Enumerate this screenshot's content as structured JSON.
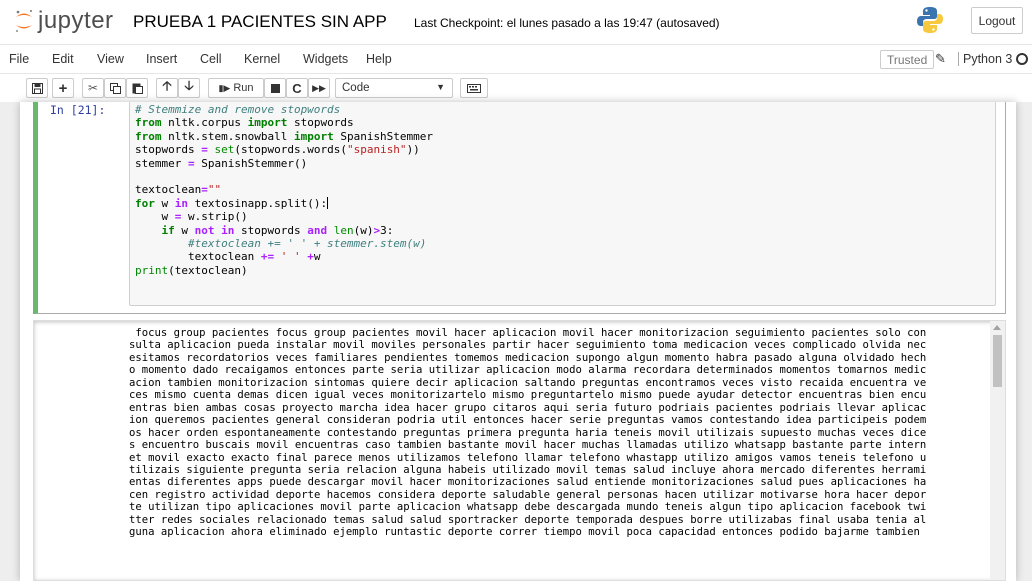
{
  "header": {
    "logo_text": "jupyter",
    "notebook_title": "PRUEBA 1 PACIENTES SIN APP",
    "checkpoint": "Last Checkpoint: el lunes pasado a las 19:47  (autosaved)",
    "logout_label": "Logout"
  },
  "menubar": {
    "items": [
      "File",
      "Edit",
      "View",
      "Insert",
      "Cell",
      "Kernel",
      "Widgets",
      "Help"
    ],
    "trusted_label": "Trusted",
    "kernel_name": "Python 3"
  },
  "toolbar": {
    "run_label": "Run",
    "cell_type": "Code"
  },
  "cell": {
    "prompt": "In [21]:",
    "code_lines": [
      "# Stemmize and remove stopwords",
      "from nltk.corpus import stopwords",
      "from nltk.stem.snowball import SpanishStemmer",
      "stopwords = set(stopwords.words(\"spanish\"))",
      "stemmer = SpanishStemmer()",
      "",
      "textoclean=\"\"",
      "for w in textosinapp.split():",
      "    w = w.strip()",
      "    if w not in stopwords and len(w)>3:",
      "        #textoclean += ' ' + stemmer.stem(w)",
      "        textoclean += ' ' +w",
      "print(textoclean)"
    ]
  },
  "output": {
    "lines": [
      " focus group pacientes focus group pacientes movil hacer aplicacion movil hacer monitorizacion seguimiento pacientes solo con",
      "sulta aplicacion pueda instalar movil moviles personales partir hacer seguimiento toma medicacion veces complicado olvida nec",
      "esitamos recordatorios veces familiares pendientes tomemos medicacion supongo algun momento habra pasado alguna olvidado hech",
      "o momento dado recaigamos entonces parte seria utilizar aplicacion modo alarma recordara determinados momentos tomarnos medic",
      "acion tambien monitorizacion sintomas quiere decir aplicacion saltando preguntas encontramos veces visto recaida encuentra ve",
      "ces mismo cuenta demas dicen igual veces monitorizartelo mismo preguntartelo mismo puede ayudar detector encuentras bien encu",
      "entras bien ambas cosas proyecto marcha idea hacer grupo citaros aqui seria futuro podriais pacientes podriais llevar aplicac",
      "ion queremos pacientes general consideran podria util entonces hacer serie preguntas vamos contestando idea participeis podem",
      "os hacer orden espontaneamente contestando preguntas primera pregunta haria teneis movil utilizais supuesto muchas veces dice",
      "s encuentro buscais movil encuentras caso tambien bastante movil hacer muchas llamadas utilizo whatsapp bastante parte intern",
      "et movil exacto exacto final parece menos utilizamos telefono llamar telefono whastapp utilizo amigos vamos teneis telefono u",
      "tilizais siguiente pregunta seria relacion alguna habeis utilizado movil temas salud incluye ahora mercado diferentes herrami",
      "entas diferentes apps puede descargar movil hacer monitorizaciones salud entiende monitorizaciones salud pues aplicaciones ha",
      "cen registro actividad deporte hacemos considera deporte saludable general personas hacen utilizar motivarse hora hacer depor",
      "te utilizan tipo aplicaciones movil parte aplicacion whatsapp debe descargada mundo teneis algun tipo aplicacion facebook twi",
      "tter redes sociales relacionado temas salud salud sportracker deporte temporada despues borre utilizabas final usaba tenia al",
      "guna aplicacion ahora eliminado ejemplo runtastic deporte correr tiempo movil poca capacidad entonces podido bajarme tambien"
    ]
  }
}
